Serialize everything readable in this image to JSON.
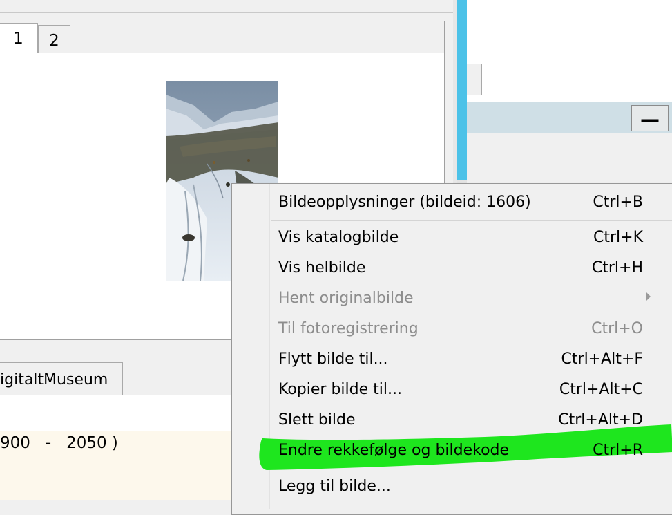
{
  "tabs": [
    {
      "label": "1",
      "active": true
    },
    {
      "label": "2",
      "active": false
    }
  ],
  "bottom_tab": {
    "label": "igitaltMuseum"
  },
  "year_range": {
    "text": "900   -   2050 )"
  },
  "minimize_button": {
    "label": "—"
  },
  "context_menu": {
    "items": [
      {
        "label": "Bildeopplysninger (bildeid: 1606)",
        "shortcut": "Ctrl+B",
        "enabled": true
      },
      {
        "label": "Vis katalogbilde",
        "shortcut": "Ctrl+K",
        "enabled": true
      },
      {
        "label": "Vis helbilde",
        "shortcut": "Ctrl+H",
        "enabled": true
      },
      {
        "label": "Hent originalbilde",
        "shortcut": "",
        "enabled": false,
        "submenu": true
      },
      {
        "label": "Til fotoregistrering",
        "shortcut": "Ctrl+O",
        "enabled": false
      },
      {
        "label": "Flytt bilde til...",
        "shortcut": "Ctrl+Alt+F",
        "enabled": true
      },
      {
        "label": "Kopier bilde til...",
        "shortcut": "Ctrl+Alt+C",
        "enabled": true
      },
      {
        "label": "Slett bilde",
        "shortcut": "Ctrl+Alt+D",
        "enabled": true
      },
      {
        "label": "Endre rekkefølge og bildekode",
        "shortcut": "Ctrl+R",
        "enabled": true,
        "highlighted": true
      },
      {
        "label": "Legg til bilde...",
        "shortcut": "",
        "enabled": true
      }
    ]
  },
  "colors": {
    "highlight": "#1ee61e",
    "splitter_accent": "#4cc2e8",
    "panel_header": "#cfdfe6",
    "cream_panel": "#fdf8ec"
  }
}
